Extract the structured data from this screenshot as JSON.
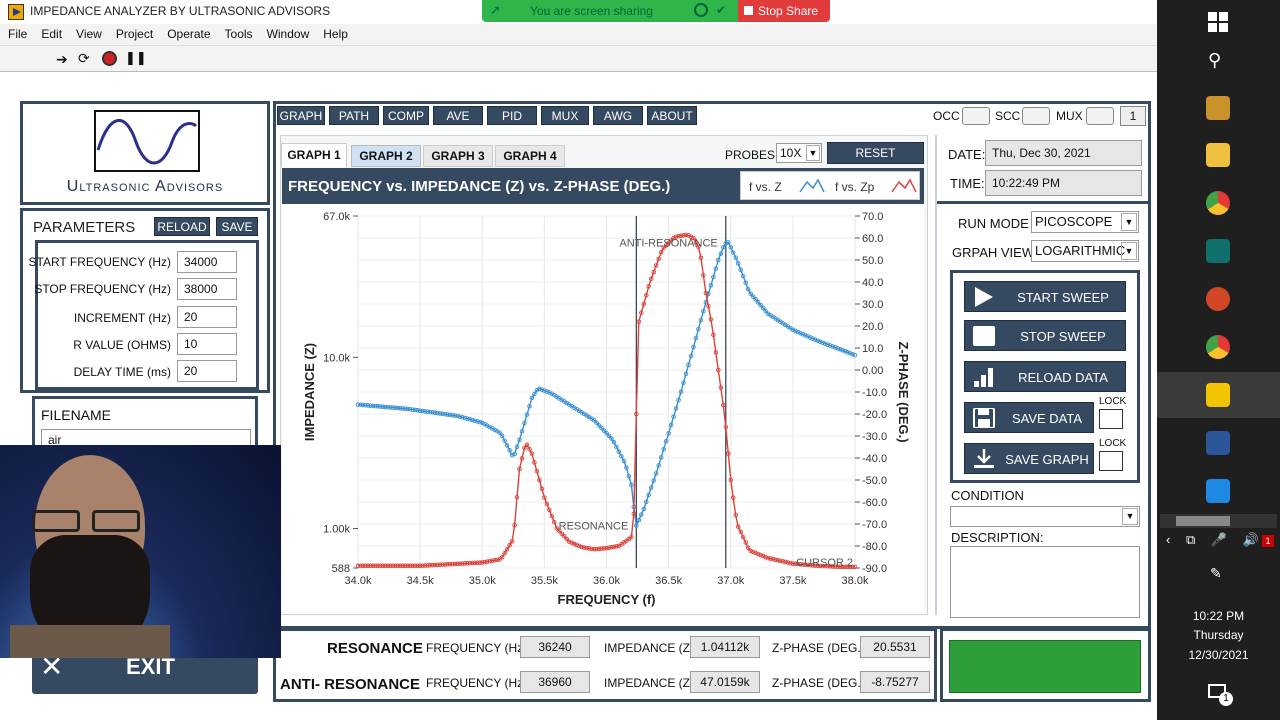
{
  "window": {
    "title": "IMPEDANCE ANALYZER BY ULTRASONIC ADVISORS"
  },
  "share": {
    "status": "You are screen sharing",
    "stop": "Stop Share"
  },
  "menu": [
    "File",
    "Edit",
    "View",
    "Project",
    "Operate",
    "Tools",
    "Window",
    "Help"
  ],
  "logo": {
    "text": "Ultrasonic Advisors"
  },
  "parameters": {
    "title": "PARAMETERS",
    "reload": "RELOAD",
    "save": "SAVE",
    "fields": [
      {
        "label": "START FREQUENCY (Hz)",
        "value": "34000"
      },
      {
        "label": "STOP FREQUENCY (Hz)",
        "value": "38000"
      },
      {
        "label": "INCREMENT (Hz)",
        "value": "20"
      },
      {
        "label": "R VALUE (OHMS)",
        "value": "10"
      },
      {
        "label": "DELAY TIME (ms)",
        "value": "20"
      }
    ]
  },
  "filename": {
    "title": "FILENAME",
    "value": "air"
  },
  "exit": "EXIT",
  "toptabs": [
    "GRAPH",
    "PATH",
    "COMP",
    "AVE",
    "PID",
    "MUX",
    "AWG",
    "ABOUT"
  ],
  "indicators": {
    "occ": "OCC",
    "scc": "SCC",
    "mux": "MUX",
    "count": "1"
  },
  "graphtabs": [
    "GRAPH 1",
    "GRAPH 2",
    "GRAPH 3",
    "GRAPH 4"
  ],
  "probes": {
    "label": "PROBES",
    "value": "10X"
  },
  "reset_cursor": "RESET CURSOR",
  "date": {
    "label": "DATE:",
    "value": "Thu, Dec 30, 2021"
  },
  "time": {
    "label": "TIME:",
    "value": "10:22:49 PM"
  },
  "run_mode": {
    "label": "RUN MODE",
    "value": "PICOSCOPE"
  },
  "graph_view": {
    "label": "GRPAH VIEW",
    "value": "LOGARITHMIC"
  },
  "buttons": {
    "start": "START SWEEP",
    "stop": "STOP SWEEP",
    "reload": "RELOAD DATA",
    "save_data": "SAVE DATA",
    "save_graph": "SAVE GRAPH",
    "lock": "LOCK"
  },
  "condition": {
    "label": "CONDITION",
    "value": ""
  },
  "description": {
    "label": "DESCRIPTION:",
    "value": ""
  },
  "results": {
    "resonance": {
      "label": "RESONANCE",
      "freq_label": "FREQUENCY (Hz)",
      "freq": "36240",
      "imp_label": "IMPEDANCE (Z)",
      "imp": "1.04112k",
      "phase_label": "Z-PHASE (DEG.)",
      "phase": "20.5531"
    },
    "anti": {
      "label": "ANTI- RESONANCE",
      "freq_label": "FREQUENCY (Hz)",
      "freq": "36960",
      "imp_label": "IMPEDANCE (Z)",
      "imp": "47.0159k",
      "phase_label": "Z-PHASE (DEG.)",
      "phase": "-8.75277"
    }
  },
  "status_color": "#2e9e3a",
  "clock": {
    "time": "10:22 PM",
    "day": "Thursday",
    "date": "12/30/2021"
  },
  "notification_count": "1",
  "chart_data": {
    "type": "line",
    "title": "FREQUENCY vs. IMPEDANCE (Z) vs. Z-PHASE (DEG.)",
    "xlabel": "FREQUENCY (f)",
    "ylabel": "IMPEDANCE (Z)",
    "y2label": "Z-PHASE (DEG.)",
    "xlim": [
      34000,
      38000
    ],
    "ylim": [
      588,
      67000
    ],
    "y_scale": "log",
    "y2lim": [
      -90,
      70
    ],
    "xticks": [
      "34.0k",
      "34.5k",
      "35.0k",
      "35.5k",
      "36.0k",
      "36.5k",
      "37.0k",
      "37.5k",
      "38.0k"
    ],
    "yticks": [
      "67.0k",
      "10.0k",
      "1.00k",
      "588"
    ],
    "y2ticks": [
      "70.0",
      "60.0",
      "50.0",
      "40.0",
      "30.0",
      "20.0",
      "10.0",
      "0.00",
      "-10.0",
      "-20.0",
      "-30.0",
      "-40.0",
      "-50.0",
      "-60.0",
      "-70.0",
      "-80.0",
      "-90.0"
    ],
    "legend": [
      "f vs. Z",
      "f vs. Zp"
    ],
    "series": [
      {
        "name": "f vs. Z",
        "color": "#3a8fd0",
        "x": [
          34000,
          34400,
          34800,
          35000,
          35150,
          35250,
          35300,
          35400,
          35450,
          35550,
          35700,
          35900,
          36050,
          36150,
          36200,
          36230,
          36240,
          36300,
          36400,
          36500,
          36600,
          36700,
          36800,
          36900,
          36950,
          36980,
          37050,
          37150,
          37300,
          37500,
          37700,
          37900,
          38000
        ],
        "y": [
          5300,
          5000,
          4550,
          4150,
          3600,
          2600,
          3300,
          5800,
          6600,
          6200,
          5300,
          4300,
          3300,
          2400,
          1800,
          1150,
          1040,
          1300,
          2100,
          3600,
          6300,
          11500,
          21000,
          37000,
          46000,
          47000,
          37000,
          24000,
          18000,
          14500,
          12500,
          11000,
          10300
        ]
      },
      {
        "name": "f vs. Zp",
        "color": "#d9433a",
        "x": [
          34000,
          34500,
          35000,
          35150,
          35250,
          35300,
          35350,
          35400,
          35500,
          35600,
          35700,
          35800,
          35900,
          36000,
          36100,
          36200,
          36230,
          36250,
          36350,
          36450,
          36550,
          36650,
          36700,
          36750,
          36800,
          36850,
          36900,
          36950,
          37000,
          37050,
          37150,
          37300,
          37500,
          37700,
          37900,
          38000
        ],
        "y": [
          -89,
          -89,
          -87.5,
          -86,
          -77,
          -45,
          -33,
          -38,
          -58,
          -72,
          -78,
          -80.5,
          -81.5,
          -81,
          -80,
          -76,
          -60,
          20,
          40,
          55,
          60.5,
          61.5,
          60,
          55,
          35,
          20,
          0,
          -20,
          -50,
          -70,
          -82,
          -85.5,
          -88,
          -89,
          -89.5,
          -89.5
        ]
      }
    ],
    "annotations": [
      "ANTI-RESONANCE",
      "RESONANCE",
      "CURSOR 2"
    ],
    "cursors_x": [
      36240,
      36960
    ]
  }
}
